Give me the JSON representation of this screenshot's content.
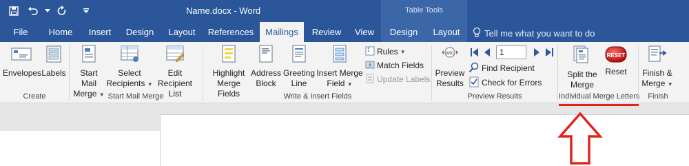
{
  "window": {
    "title": "Name.docx - Word",
    "context_group": "Table Tools"
  },
  "qat": {
    "save_icon": "save-icon",
    "undo_icon": "undo-icon",
    "redo_icon": "redo-icon",
    "customize_icon": "customize-qat-icon"
  },
  "tabs": [
    {
      "label": "File"
    },
    {
      "label": "Home"
    },
    {
      "label": "Insert"
    },
    {
      "label": "Design"
    },
    {
      "label": "Layout"
    },
    {
      "label": "References"
    },
    {
      "label": "Mailings"
    },
    {
      "label": "Review"
    },
    {
      "label": "View"
    },
    {
      "label": "Design"
    },
    {
      "label": "Layout"
    }
  ],
  "active_tab": "Mailings",
  "tell_me": {
    "placeholder": "Tell me what you want to do"
  },
  "groups": {
    "create": {
      "label": "Create",
      "envelopes": "Envelopes",
      "labels": "Labels"
    },
    "start_mail_merge": {
      "label": "Start Mail Merge",
      "start_l1": "Start Mail",
      "start_l2": "Merge",
      "select_l1": "Select",
      "select_l2": "Recipients",
      "edit_l1": "Edit",
      "edit_l2": "Recipient List"
    },
    "write_insert": {
      "label": "Write & Insert Fields",
      "highlight_l1": "Highlight",
      "highlight_l2": "Merge Fields",
      "address_l1": "Address",
      "address_l2": "Block",
      "greeting_l1": "Greeting",
      "greeting_l2": "Line",
      "insert_l1": "Insert Merge",
      "insert_l2": "Field",
      "rules": "Rules",
      "match_fields": "Match Fields",
      "update_labels": "Update Labels"
    },
    "preview": {
      "label": "Preview Results",
      "preview_l1": "Preview",
      "preview_l2": "Results",
      "record": "1",
      "find_recipient": "Find Recipient",
      "check_errors": "Check for Errors"
    },
    "individual": {
      "label": "Individual Merge Letters",
      "split_l1": "Split the",
      "split_l2": "Merge",
      "reset": "Reset",
      "reset_badge": "RESET"
    },
    "finish": {
      "label": "Finish",
      "finish_l1": "Finish &",
      "finish_l2": "Merge"
    }
  },
  "colors": {
    "accent": "#2b579a",
    "annotation": "#e2231a"
  }
}
